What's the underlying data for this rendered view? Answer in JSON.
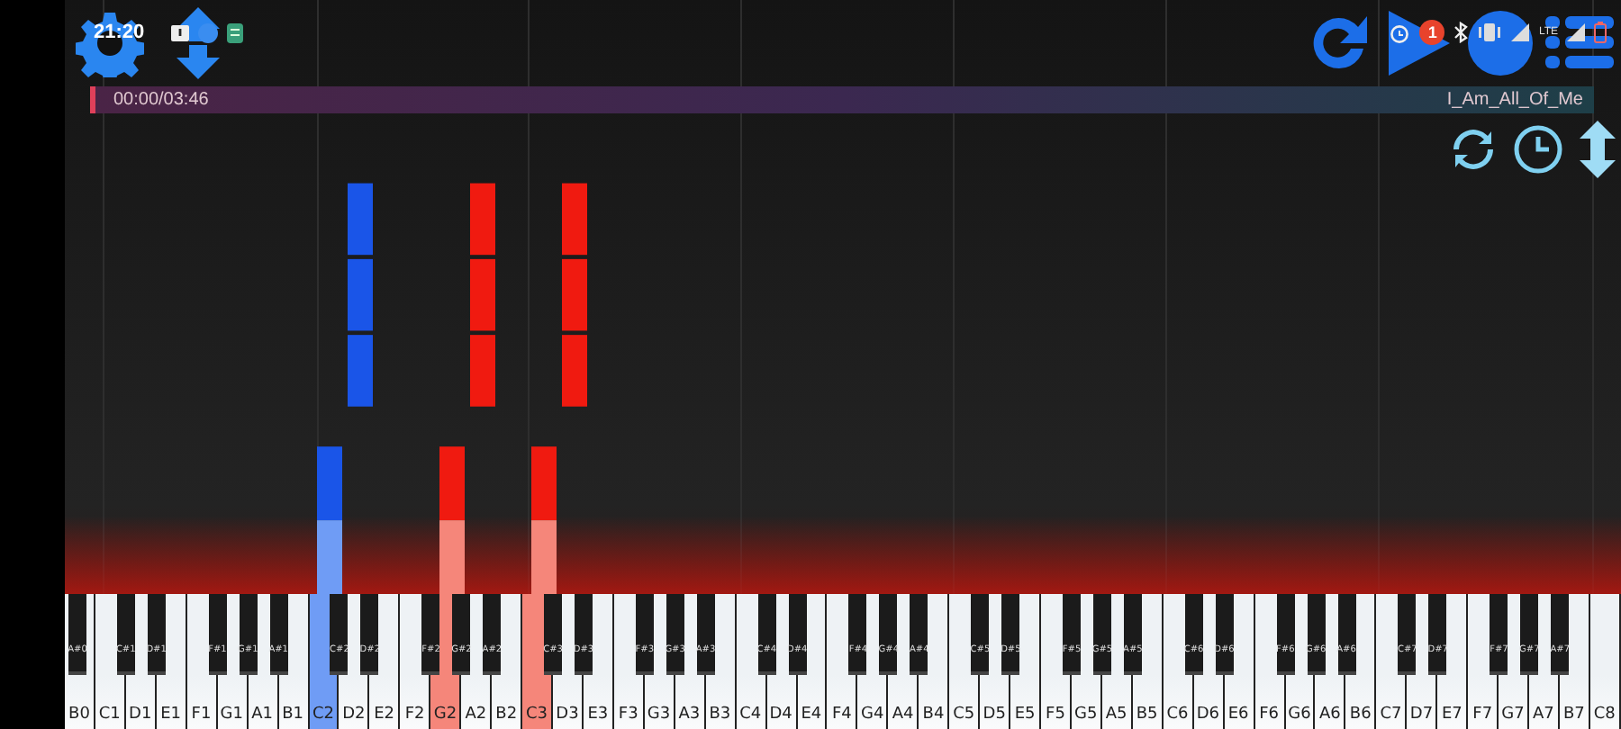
{
  "status_bar": {
    "time": "21:20",
    "notification_count": "1",
    "network": "LTE"
  },
  "player": {
    "elapsed": "00:00/03:46",
    "song": "I_Am_All_Of_Me",
    "level": 0
  },
  "keyboard": {
    "white_keys": [
      {
        "label": "B0",
        "pressed": false,
        "black_key": {
          "label": "A#0"
        }
      },
      {
        "label": "C1",
        "pressed": false
      },
      {
        "label": "D1",
        "pressed": false,
        "black_key": {
          "label": "C#1"
        }
      },
      {
        "label": "E1",
        "pressed": false,
        "black_key": {
          "label": "D#1"
        }
      },
      {
        "label": "F1",
        "pressed": false
      },
      {
        "label": "G1",
        "pressed": false,
        "black_key": {
          "label": "F#1"
        }
      },
      {
        "label": "A1",
        "pressed": false,
        "black_key": {
          "label": "G#1"
        }
      },
      {
        "label": "B1",
        "pressed": false,
        "black_key": {
          "label": "A#1"
        }
      },
      {
        "label": "C2",
        "pressed": true,
        "color": "#6f9cf5"
      },
      {
        "label": "D2",
        "pressed": false,
        "black_key": {
          "label": "C#2"
        }
      },
      {
        "label": "E2",
        "pressed": false,
        "black_key": {
          "label": "D#2"
        }
      },
      {
        "label": "F2",
        "pressed": false
      },
      {
        "label": "G2",
        "pressed": true,
        "color": "#f5867a",
        "black_key": {
          "label": "F#2"
        }
      },
      {
        "label": "A2",
        "pressed": false,
        "black_key": {
          "label": "G#2"
        }
      },
      {
        "label": "B2",
        "pressed": false,
        "black_key": {
          "label": "A#2"
        }
      },
      {
        "label": "C3",
        "pressed": true,
        "color": "#f5867a"
      },
      {
        "label": "D3",
        "pressed": false,
        "black_key": {
          "label": "C#3"
        }
      },
      {
        "label": "E3",
        "pressed": false,
        "black_key": {
          "label": "D#3"
        }
      },
      {
        "label": "F3",
        "pressed": false
      },
      {
        "label": "G3",
        "pressed": false,
        "black_key": {
          "label": "F#3"
        }
      },
      {
        "label": "A3",
        "pressed": false,
        "black_key": {
          "label": "G#3"
        }
      },
      {
        "label": "B3",
        "pressed": false,
        "black_key": {
          "label": "A#3"
        }
      },
      {
        "label": "C4",
        "pressed": false
      },
      {
        "label": "D4",
        "pressed": false,
        "black_key": {
          "label": "C#4"
        }
      },
      {
        "label": "E4",
        "pressed": false,
        "black_key": {
          "label": "D#4"
        }
      },
      {
        "label": "F4",
        "pressed": false
      },
      {
        "label": "G4",
        "pressed": false,
        "black_key": {
          "label": "F#4"
        }
      },
      {
        "label": "A4",
        "pressed": false,
        "black_key": {
          "label": "G#4"
        }
      },
      {
        "label": "B4",
        "pressed": false,
        "black_key": {
          "label": "A#4"
        }
      },
      {
        "label": "C5",
        "pressed": false
      },
      {
        "label": "D5",
        "pressed": false,
        "black_key": {
          "label": "C#5"
        }
      },
      {
        "label": "E5",
        "pressed": false,
        "black_key": {
          "label": "D#5"
        }
      },
      {
        "label": "F5",
        "pressed": false
      },
      {
        "label": "G5",
        "pressed": false,
        "black_key": {
          "label": "F#5"
        }
      },
      {
        "label": "A5",
        "pressed": false,
        "black_key": {
          "label": "G#5"
        }
      },
      {
        "label": "B5",
        "pressed": false,
        "black_key": {
          "label": "A#5"
        }
      },
      {
        "label": "C6",
        "pressed": false
      },
      {
        "label": "D6",
        "pressed": false,
        "black_key": {
          "label": "C#6"
        }
      },
      {
        "label": "E6",
        "pressed": false,
        "black_key": {
          "label": "D#6"
        }
      },
      {
        "label": "F6",
        "pressed": false
      },
      {
        "label": "G6",
        "pressed": false,
        "black_key": {
          "label": "F#6"
        }
      },
      {
        "label": "A6",
        "pressed": false,
        "black_key": {
          "label": "G#6"
        }
      },
      {
        "label": "B6",
        "pressed": false,
        "black_key": {
          "label": "A#6"
        }
      },
      {
        "label": "C7",
        "pressed": false
      },
      {
        "label": "D7",
        "pressed": false,
        "black_key": {
          "label": "C#7"
        }
      },
      {
        "label": "E7",
        "pressed": false,
        "black_key": {
          "label": "D#7"
        }
      },
      {
        "label": "F7",
        "pressed": false
      },
      {
        "label": "G7",
        "pressed": false,
        "black_key": {
          "label": "F#7"
        }
      },
      {
        "label": "A7",
        "pressed": false,
        "black_key": {
          "label": "G#7"
        }
      },
      {
        "label": "B7",
        "pressed": false,
        "black_key": {
          "label": "A#7"
        }
      },
      {
        "label": "C8",
        "pressed": false
      }
    ]
  }
}
